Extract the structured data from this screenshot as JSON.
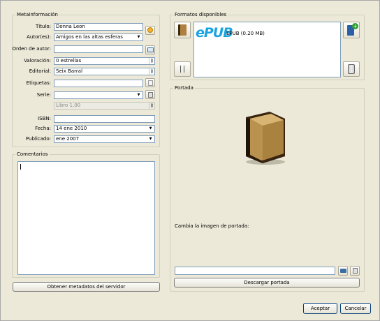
{
  "meta": {
    "legend": "Metainformación",
    "title_label": "Título:",
    "title_value": "Donna Leon",
    "authors_label": "Autor(es):",
    "authors_value": "Amigos en las altas esferas",
    "author_order_label": "Orden de autor:",
    "author_order_value": "",
    "rating_label": "Valoración:",
    "rating_value": "0 estrellas",
    "publisher_label": "Editorial:",
    "publisher_value": "Seix Barral",
    "tags_label": "Etiquetas:",
    "tags_value": "",
    "series_label": "Serie:",
    "series_value": "",
    "series_index_value": "Libro 1,00",
    "isbn_label": "ISBN:",
    "isbn_value": "",
    "date_label": "Fecha:",
    "date_value": "14 ene 2010",
    "published_label": "Publicado:",
    "published_value": "ene 2007"
  },
  "comments": {
    "legend": "Comentarios",
    "value": ""
  },
  "fetch_button": "Obtener metadatos del servidor",
  "formats": {
    "legend": "Formatos disponibles",
    "items": [
      {
        "badge": "ePUB",
        "label": "EPUB (0.20 MB)"
      }
    ]
  },
  "cover": {
    "legend": "Portada",
    "change_label": "Cambia la imagen de portada:",
    "path_value": "",
    "download_button": "Descargar portada"
  },
  "dialog": {
    "accept": "Aceptar",
    "cancel": "Cancelar"
  },
  "colors": {
    "epub_blue": "#1aa3e0",
    "window_bg": "#ece9d8"
  }
}
